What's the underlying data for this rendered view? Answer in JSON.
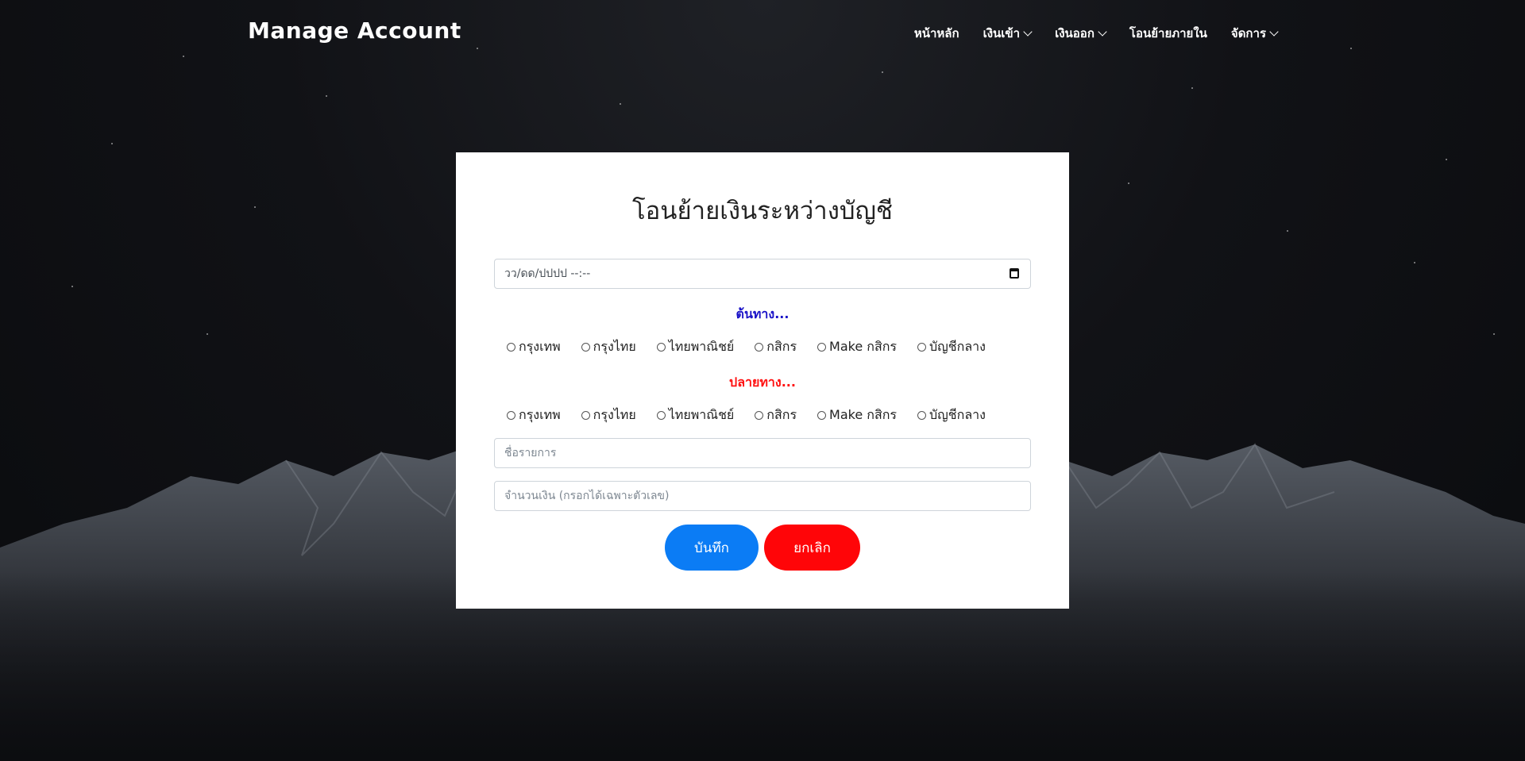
{
  "navbar": {
    "brand": "Manage Account",
    "items": [
      {
        "label": "หน้าหลัก",
        "dropdown": false
      },
      {
        "label": "เงินเข้า",
        "dropdown": true
      },
      {
        "label": "เงินออก",
        "dropdown": true
      },
      {
        "label": "โอนย้ายภายใน",
        "dropdown": false
      },
      {
        "label": "จัดการ",
        "dropdown": true
      }
    ]
  },
  "form": {
    "title": "โอนย้ายเงินระหว่างบัญชี",
    "datetime_placeholder": "วว/ดด/ปปปป --:--",
    "source_label": "ต้นทาง...",
    "destination_label": "ปลายทาง...",
    "source_options": [
      "กรุงเทพ",
      "กรุงไทย",
      "ไทยพาณิชย์",
      "กสิกร",
      "Make กสิกร",
      "บัญชีกลาง"
    ],
    "destination_options": [
      "กรุงเทพ",
      "กรุงไทย",
      "ไทยพาณิชย์",
      "กสิกร",
      "Make กสิกร",
      "บัญชีกลาง"
    ],
    "item_name_placeholder": "ชื่อรายการ",
    "amount_placeholder": "จำนวนเงิน (กรอกได้เฉพาะตัวเลข)",
    "save_label": "บันทึก",
    "cancel_label": "ยกเลิก"
  },
  "colors": {
    "source_label": "#1a12c7",
    "destination_label": "#ff1010",
    "save_button": "#0b7cf5",
    "cancel_button": "#ff0508",
    "accent_underline": "#1479ff"
  }
}
